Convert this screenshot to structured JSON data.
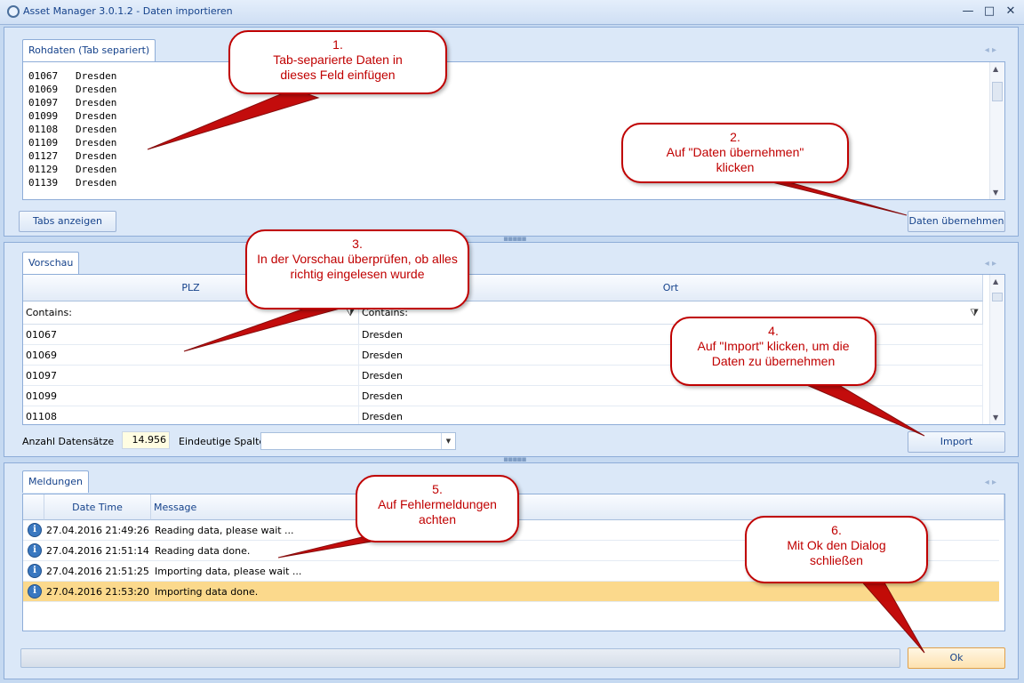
{
  "window": {
    "title": "Asset Manager 3.0.1.2 - Daten importieren",
    "minimize": "—",
    "maximize": "□",
    "close": "✕"
  },
  "raw": {
    "tab": "Rohdaten (Tab separiert)",
    "lines": [
      "01067   Dresden",
      "01069   Dresden",
      "01097   Dresden",
      "01099   Dresden",
      "01108   Dresden",
      "01109   Dresden",
      "01127   Dresden",
      "01129   Dresden",
      "01139   Dresden"
    ],
    "show_tabs_label": "Tabs anzeigen",
    "apply_label": "Daten übernehmen"
  },
  "preview": {
    "tab": "Vorschau",
    "columns": [
      "PLZ",
      "Ort"
    ],
    "filter": [
      "Contains:",
      "Contains:"
    ],
    "rows": [
      [
        "01067",
        "Dresden"
      ],
      [
        "01069",
        "Dresden"
      ],
      [
        "01097",
        "Dresden"
      ],
      [
        "01099",
        "Dresden"
      ],
      [
        "01108",
        "Dresden"
      ]
    ],
    "count_label": "Anzahl Datensätze",
    "count_value": "14.956",
    "unique_label": "Eindeutige Spalte",
    "import_label": "Import"
  },
  "messages": {
    "tab": "Meldungen",
    "columns": [
      "Date Time",
      "Message"
    ],
    "rows": [
      {
        "time": "27.04.2016 21:49:26",
        "msg": "Reading data, please wait ..."
      },
      {
        "time": "27.04.2016 21:51:14",
        "msg": "Reading data done."
      },
      {
        "time": "27.04.2016 21:51:25",
        "msg": "Importing data, please wait ..."
      },
      {
        "time": "27.04.2016 21:53:20",
        "msg": "Importing data done."
      }
    ],
    "selected_row": 3,
    "ok_label": "Ok"
  },
  "callouts": [
    {
      "num": "1.",
      "text": "Tab-separierte Daten in dieses Feld einfügen"
    },
    {
      "num": "2.",
      "text": "Auf \"Daten übernehmen\" klicken"
    },
    {
      "num": "3.",
      "text": "In der Vorschau überprüfen, ob alles richtig eingelesen wurde"
    },
    {
      "num": "4.",
      "text": "Auf \"Import\" klicken, um die Daten zu übernehmen"
    },
    {
      "num": "5.",
      "text": "Auf Fehlermeldungen achten"
    },
    {
      "num": "6.",
      "text": "Mit Ok den Dialog schließen"
    }
  ],
  "colors": {
    "callout": "#c00000",
    "selected_row": "#fbd98c"
  }
}
